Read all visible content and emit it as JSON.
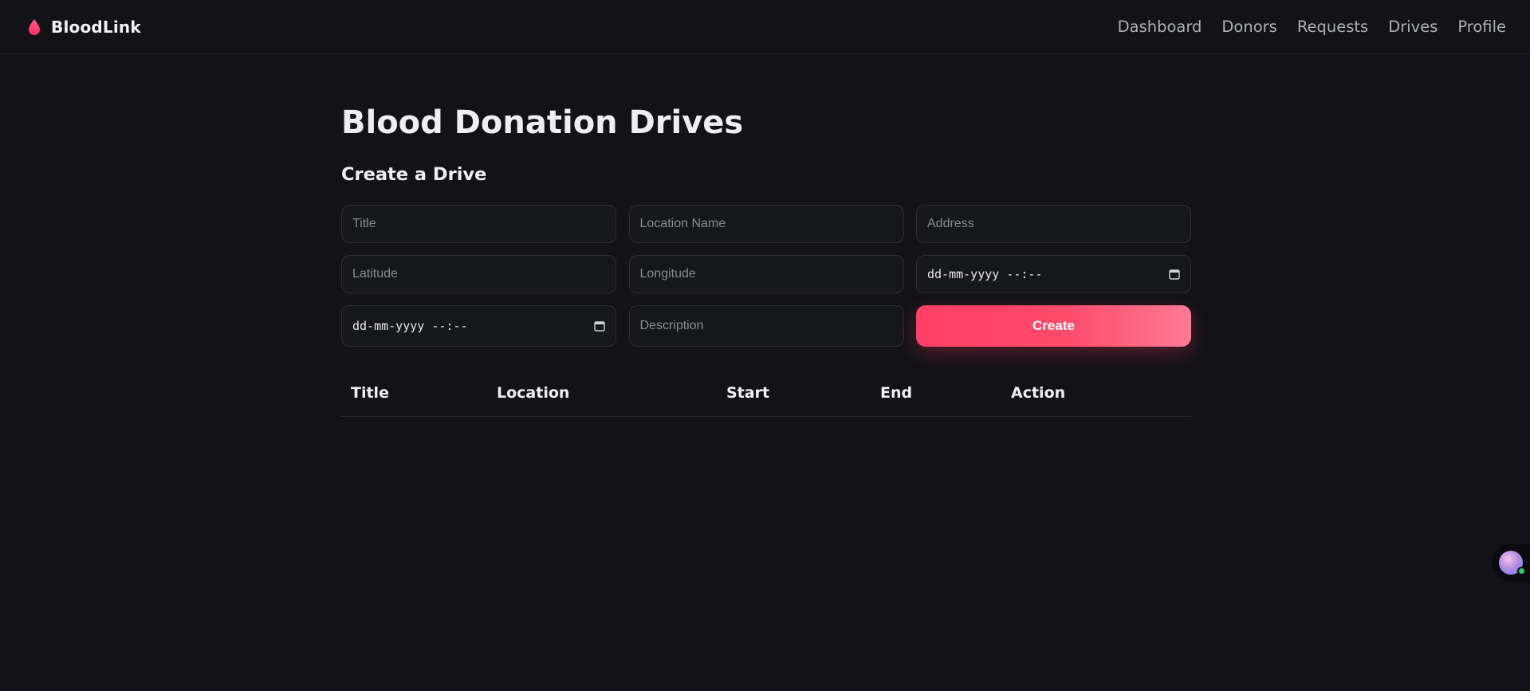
{
  "brand": {
    "name": "BloodLink",
    "accent_color": "#ff3f66",
    "icon": "blood-drop-icon"
  },
  "nav": {
    "items": [
      {
        "label": "Dashboard"
      },
      {
        "label": "Donors"
      },
      {
        "label": "Requests"
      },
      {
        "label": "Drives"
      },
      {
        "label": "Profile"
      }
    ]
  },
  "page": {
    "title": "Blood Donation Drives"
  },
  "form": {
    "heading": "Create a Drive",
    "title_placeholder": "Title",
    "location_name_placeholder": "Location Name",
    "address_placeholder": "Address",
    "latitude_placeholder": "Latitude",
    "longitude_placeholder": "Longitude",
    "start_datetime": "dd-mm-yyyy --:--",
    "end_datetime": "dd-mm-yyyy --:--",
    "description_placeholder": "Description",
    "submit_label": "Create",
    "date_icon": "calendar-icon"
  },
  "table": {
    "columns": [
      "Title",
      "Location",
      "Start",
      "End",
      "Action"
    ],
    "rows": []
  },
  "assistant": {
    "icon": "assistant-avatar-icon",
    "status_color": "#2ecc71"
  }
}
